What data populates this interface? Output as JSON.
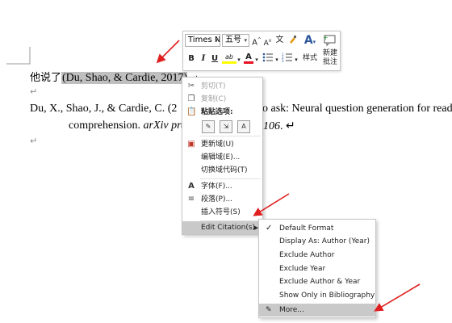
{
  "document": {
    "para_marks": "↵",
    "line1_zh": "他说了",
    "citation_text": "(Du, Shao, & Cardie, 2017)",
    "line1_tail": " .↵",
    "ref_line1": "Du, X., Shao, J., & Cardie, C. (2",
    "ref_line1_rest": "o ask: Neural question generation for read",
    "ref_line2_a": "comprehension.",
    "ref_line2_b": "arXiv prep",
    "ref_line2_c": "106",
    "ref_line2_d": ". ↵"
  },
  "mini_toolbar": {
    "font_name": "Times N",
    "font_size": "五号",
    "grow_font": "A",
    "shrink_font": "A",
    "phonetic": "文",
    "format_painter_icon": "paintbrush-icon",
    "bold": "B",
    "italic": "I",
    "underline": "U",
    "highlight": "ab",
    "font_color": "A",
    "styles_label": "样式",
    "new_comment_label_1": "新建",
    "new_comment_label_2": "批注"
  },
  "context_menu": {
    "items": [
      {
        "label": "剪切(T)",
        "icon": "scissors-icon",
        "disabled": true
      },
      {
        "label": "复制(C)",
        "icon": "copy-icon",
        "disabled": true
      },
      {
        "label": "粘贴选项:",
        "icon": "paste-icon",
        "disabled": false
      },
      {
        "label": "更新域(U)",
        "icon": "update-field-icon",
        "disabled": false
      },
      {
        "label": "编辑域(E)...",
        "icon": "",
        "disabled": false
      },
      {
        "label": "切换域代码(T)",
        "icon": "",
        "disabled": false
      },
      {
        "label": "字体(F)...",
        "icon": "font-icon",
        "disabled": false
      },
      {
        "label": "段落(P)...",
        "icon": "paragraph-icon",
        "disabled": false
      },
      {
        "label": "插入符号(S)",
        "icon": "",
        "disabled": false
      },
      {
        "label": "Edit Citation(s)",
        "icon": "",
        "disabled": false,
        "highlighted": true
      }
    ],
    "paste_options": [
      "keep-source-icon",
      "merge-format-icon",
      "keep-text-only-icon"
    ]
  },
  "submenu": {
    "items": [
      {
        "label": "Default Format",
        "checked": true
      },
      {
        "label": "Display As: Author (Year)",
        "checked": false
      },
      {
        "label": "Exclude Author",
        "checked": false
      },
      {
        "label": "Exclude Year",
        "checked": false
      },
      {
        "label": "Exclude Author & Year",
        "checked": false
      },
      {
        "label": "Show Only in Bibliography",
        "checked": false
      },
      {
        "label": "More...",
        "checked": false,
        "highlighted": true
      }
    ]
  },
  "colors": {
    "highlight_yellow": "#ffff00",
    "font_red": "#e81123",
    "accent_blue": "#2b579a",
    "annotation_arrow": "#e02020",
    "menu_highlight": "#c9c9c9"
  }
}
